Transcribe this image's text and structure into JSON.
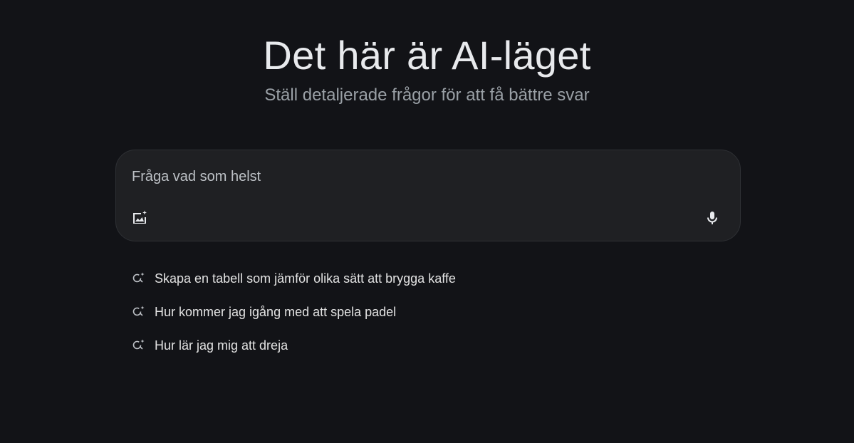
{
  "header": {
    "title": "Det här är AI-läget",
    "subtitle": "Ställ detaljerade frågor för att få bättre svar"
  },
  "search": {
    "placeholder": "Fråga vad som helst",
    "value": "",
    "image_upload_icon": "add-image-icon",
    "mic_icon": "microphone-icon"
  },
  "suggestions": {
    "icon": "search-sparkle-icon",
    "items": [
      {
        "label": "Skapa en tabell som jämför olika sätt att brygga kaffe"
      },
      {
        "label": "Hur kommer jag igång med att spela padel"
      },
      {
        "label": "Hur lär jag mig att dreja"
      }
    ]
  },
  "colors": {
    "background": "#121317",
    "search_box": "#1f2023",
    "text_primary": "#e8eaed",
    "text_secondary": "#9aa0a6"
  }
}
